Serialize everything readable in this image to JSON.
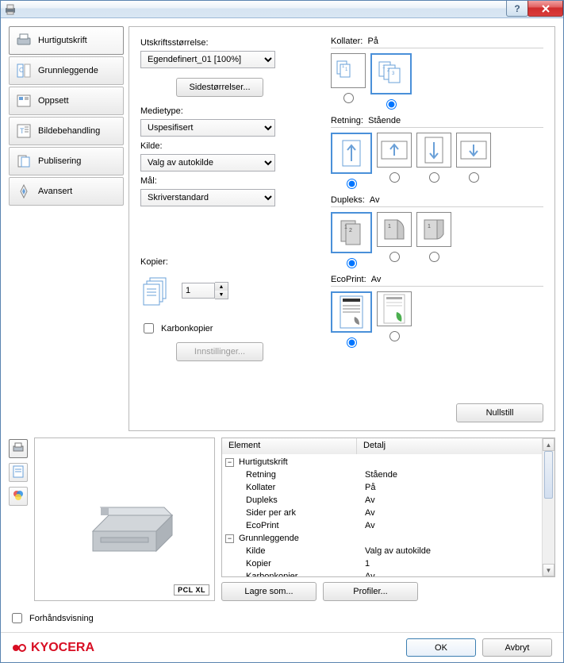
{
  "window": {
    "title": ""
  },
  "tabs": {
    "quick": {
      "label": "Hurtigutskrift"
    },
    "basic": {
      "label": "Grunnleggende"
    },
    "layout": {
      "label": "Oppsett"
    },
    "image": {
      "label": "Bildebehandling"
    },
    "publish": {
      "label": "Publisering"
    },
    "advanced": {
      "label": "Avansert"
    }
  },
  "quick": {
    "print_size_label": "Utskriftsstørrelse:",
    "print_size_value": "Egendefinert_01 [100%]",
    "page_sizes_btn": "Sidestørrelser...",
    "media_type_label": "Medietype:",
    "media_type_value": "Uspesifisert",
    "source_label": "Kilde:",
    "source_value": "Valg av autokilde",
    "dest_label": "Mål:",
    "dest_value": "Skriverstandard",
    "copies_label": "Kopier:",
    "copies_value": "1",
    "carbon_label": "Karbonkopier",
    "carbon_settings_btn": "Innstillinger...",
    "collate": {
      "title": "Kollater:",
      "value": "På"
    },
    "orientation": {
      "title": "Retning:",
      "value": "Stående"
    },
    "duplex": {
      "title": "Dupleks:",
      "value": "Av"
    },
    "ecoprint": {
      "title": "EcoPrint:",
      "value": "Av"
    },
    "reset_btn": "Nullstill"
  },
  "preview": {
    "badge": "PCL XL",
    "checkbox_label": "Forhåndsvisning"
  },
  "details": {
    "col_element": "Element",
    "col_detail": "Detalj",
    "groups": [
      {
        "name": "Hurtigutskrift",
        "rows": [
          {
            "k": "Retning",
            "v": "Stående"
          },
          {
            "k": "Kollater",
            "v": "På"
          },
          {
            "k": "Dupleks",
            "v": "Av"
          },
          {
            "k": "Sider per ark",
            "v": "Av"
          },
          {
            "k": "EcoPrint",
            "v": "Av"
          }
        ]
      },
      {
        "name": "Grunnleggende",
        "rows": [
          {
            "k": "Kilde",
            "v": "Valg av autokilde"
          },
          {
            "k": "Kopier",
            "v": "1"
          },
          {
            "k": "Karbonkopier",
            "v": "Av"
          }
        ]
      }
    ],
    "save_as_btn": "Lagre som...",
    "profiles_btn": "Profiler..."
  },
  "footer": {
    "brand": "KYOCERA",
    "ok": "OK",
    "cancel": "Avbryt"
  }
}
